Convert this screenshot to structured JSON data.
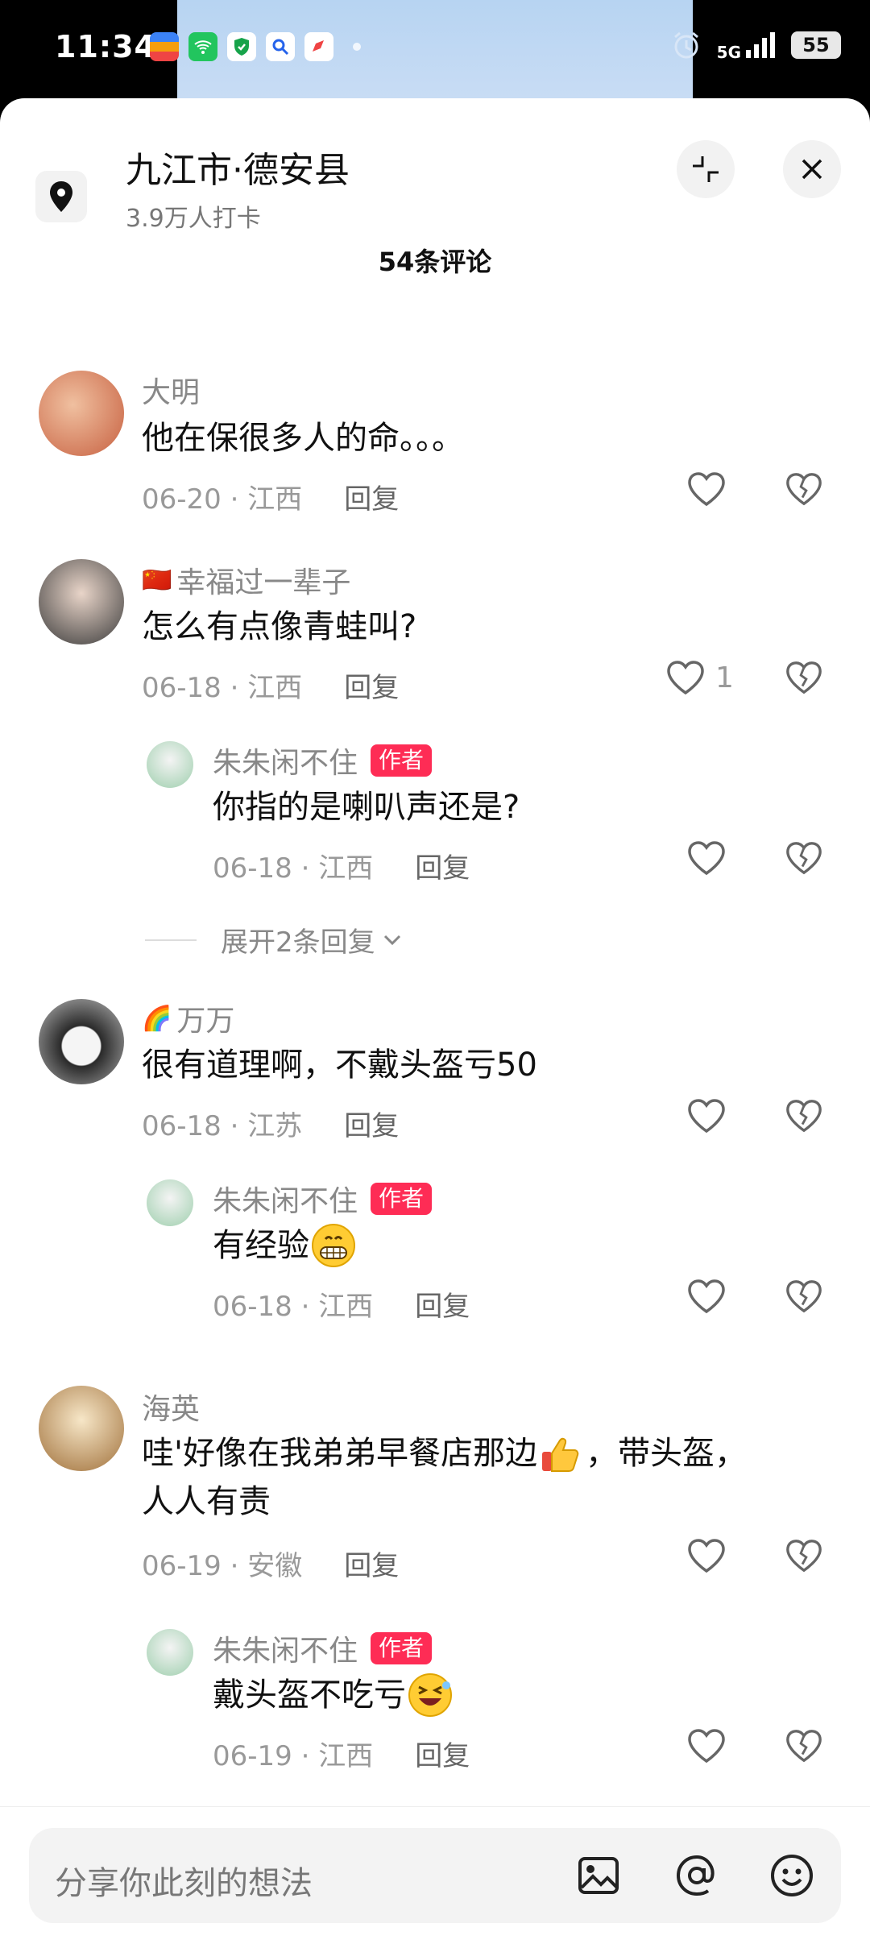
{
  "status_bar": {
    "time": "11:34",
    "network": "5G",
    "battery": "55",
    "app_icons": [
      "wallet-icon",
      "wifi-app-icon",
      "shield-app-icon",
      "search-app-icon",
      "compass-app-icon"
    ]
  },
  "header": {
    "location_title": "九江市·德安县",
    "checkins": "3.9万人打卡",
    "comment_count": "54条评论"
  },
  "comments": [
    {
      "user": "大明",
      "text": "他在保很多人的命。。。",
      "date_region": "06-20 · 江西",
      "reply_label": "回复",
      "likes": ""
    },
    {
      "user": "幸福过一辈子",
      "user_flag": "🇨🇳",
      "text": "怎么有点像青蛙叫?",
      "date_region": "06-18 · 江西",
      "reply_label": "回复",
      "likes": "1",
      "replies": [
        {
          "user": "朱朱闲不住",
          "badge": "作者",
          "text": "你指的是喇叭声还是?",
          "date_region": "06-18 · 江西",
          "reply_label": "回复"
        }
      ],
      "expand_label": "展开2条回复"
    },
    {
      "user": "万万",
      "user_flag": "🌈",
      "text": "很有道理啊，不戴头盔亏50",
      "date_region": "06-18 · 江苏",
      "reply_label": "回复",
      "replies": [
        {
          "user": "朱朱闲不住",
          "badge": "作者",
          "text": "有经验",
          "date_region": "06-18 · 江西",
          "reply_label": "回复"
        }
      ]
    },
    {
      "user": "海英",
      "text_line1": "哇'好像在我弟弟早餐店那边",
      "text_line1_tail": "，带头盔，",
      "text_line2": "人人有责",
      "date_region": "06-19 · 安徽",
      "reply_label": "回复",
      "replies": [
        {
          "user": "朱朱闲不住",
          "badge": "作者",
          "text": "戴头盔不吃亏",
          "date_region": "06-19 · 江西",
          "reply_label": "回复"
        }
      ]
    }
  ],
  "composer": {
    "placeholder": "分享你此刻的想法"
  },
  "colors": {
    "accent": "#fe2c55",
    "muted_text": "#999999",
    "primary_text": "#111111"
  }
}
